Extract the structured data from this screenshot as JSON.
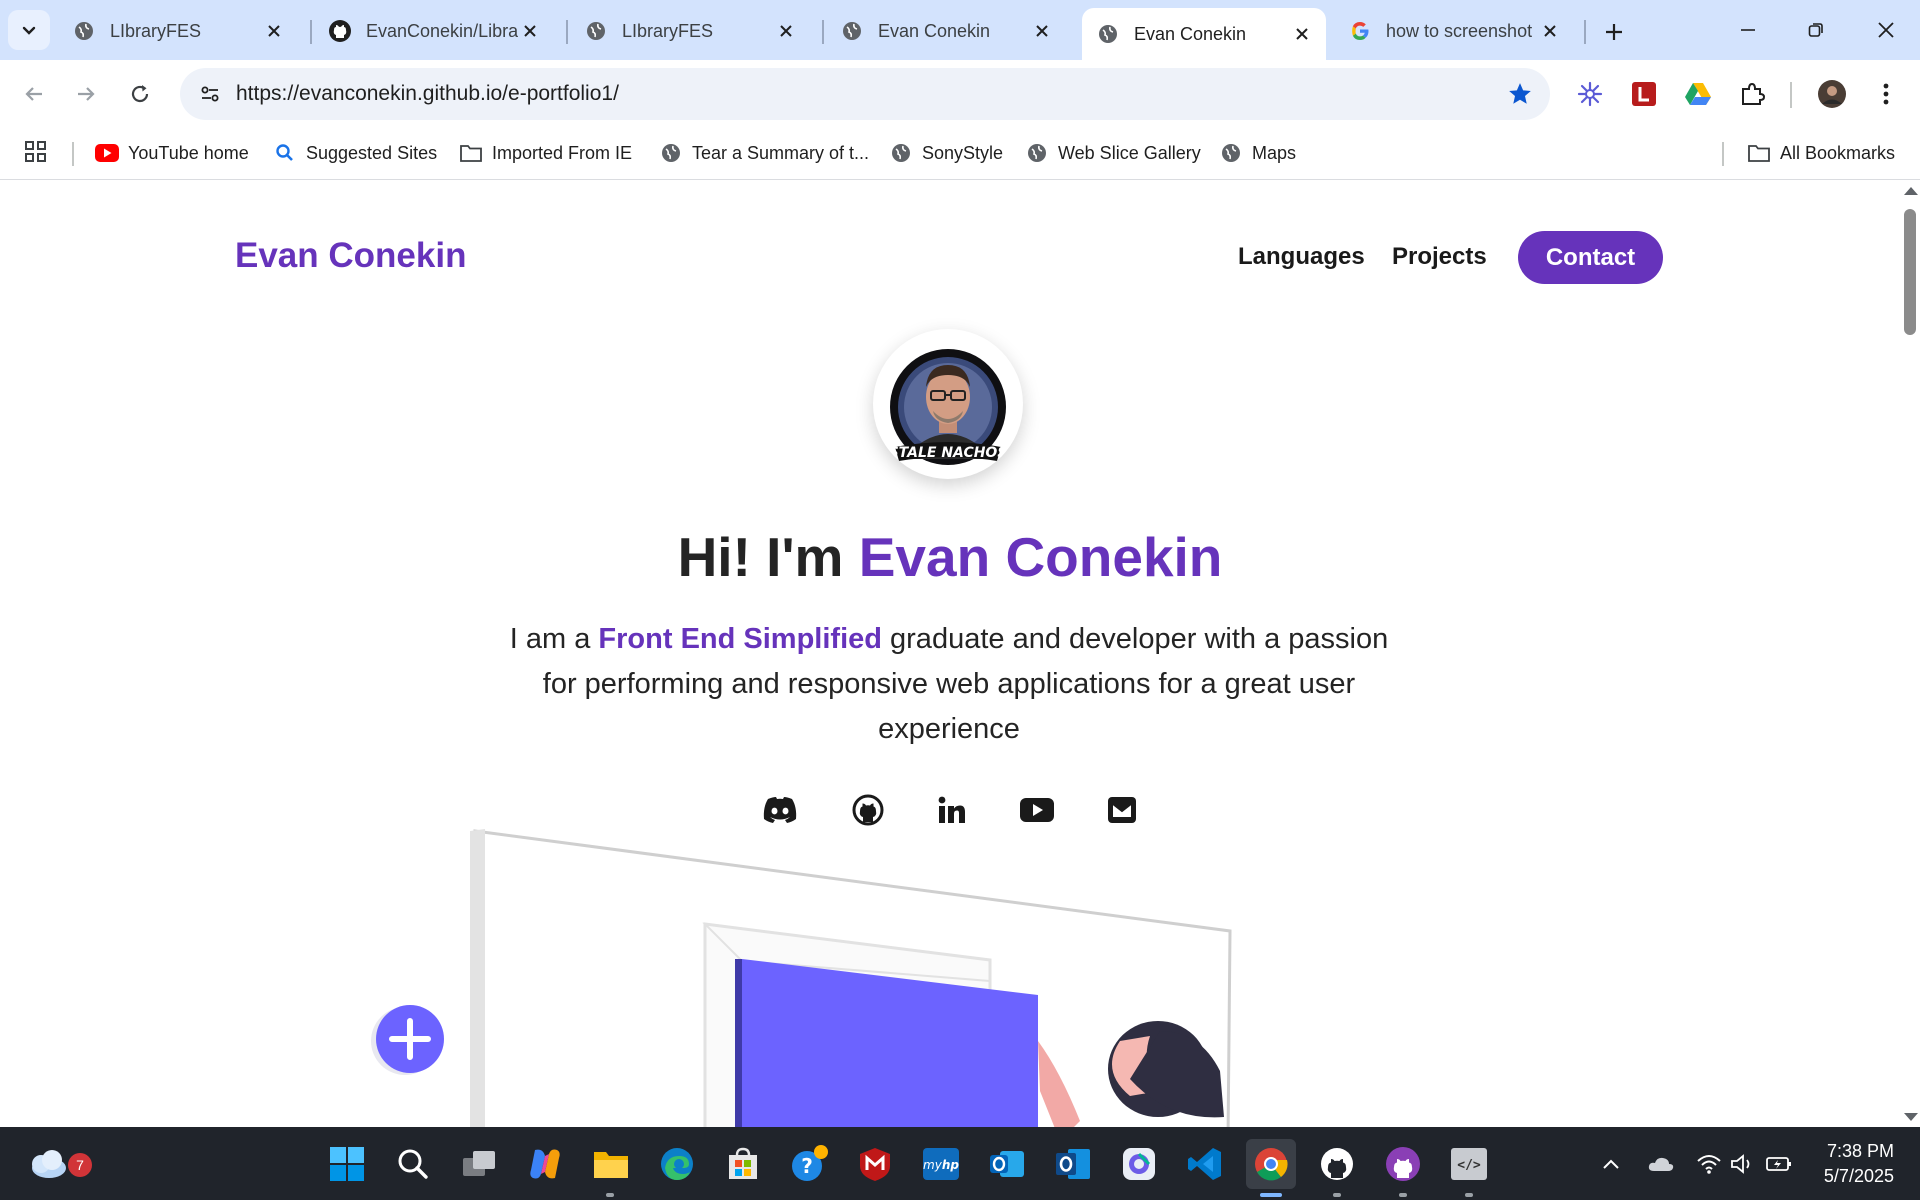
{
  "browser": {
    "tabs": [
      {
        "title": "LIbraryFES",
        "favicon": "globe-icon",
        "active": false
      },
      {
        "title": "EvanConekin/Libra",
        "favicon": "github-icon",
        "active": false
      },
      {
        "title": "LIbraryFES",
        "favicon": "globe-icon",
        "active": false
      },
      {
        "title": "Evan Conekin",
        "favicon": "globe-icon",
        "active": false
      },
      {
        "title": "Evan Conekin",
        "favicon": "globe-icon",
        "active": true
      },
      {
        "title": "how to screenshot",
        "favicon": "google-icon",
        "active": false
      }
    ],
    "url": "https://evanconekin.github.io/e-portfolio1/",
    "bookmarks": [
      {
        "label": "YouTube home",
        "icon": "youtube-icon"
      },
      {
        "label": "Suggested Sites",
        "icon": "search-icon"
      },
      {
        "label": "Imported From IE",
        "icon": "folder-icon"
      },
      {
        "label": "Tear a Summary of t...",
        "icon": "globe-icon"
      },
      {
        "label": "SonyStyle",
        "icon": "globe-icon"
      },
      {
        "label": "Web Slice Gallery",
        "icon": "globe-icon"
      },
      {
        "label": "Maps",
        "icon": "globe-icon"
      }
    ],
    "all_bookmarks": "All Bookmarks"
  },
  "site": {
    "brand": "Evan Conekin",
    "nav": {
      "languages": "Languages",
      "projects": "Projects",
      "contact": "Contact"
    },
    "avatar_caption": "STALE NACHOS",
    "heading_prefix": "Hi! I'm ",
    "heading_name": "Evan Conekin",
    "intro_prefix": "I am a ",
    "intro_highlight": "Front End Simplified",
    "intro_suffix": " graduate and developer with a passion for performing and responsive web applications for a great user experience",
    "socials": [
      "discord-icon",
      "github-icon",
      "linkedin-icon",
      "youtube-icon",
      "mail-icon"
    ]
  },
  "colors": {
    "accent": "#6633bb",
    "tabstrip": "#d3e3fd",
    "taskbar": "#20242b",
    "illustration_screen": "#6c63ff"
  },
  "taskbar": {
    "weather_badge": "7",
    "time": "7:38 PM",
    "date": "5/7/2025",
    "apps": [
      "start-icon",
      "search-icon",
      "task-view-icon",
      "copilot-icon",
      "file-explorer-icon",
      "edge-icon",
      "store-icon",
      "help-icon",
      "mcafee-icon",
      "myhp-icon",
      "outlook-icon",
      "outlook-new-icon",
      "photos-icon",
      "vscode-icon",
      "chrome-icon",
      "github-desktop-icon",
      "github-purple-icon",
      "dev-tools-icon"
    ]
  }
}
